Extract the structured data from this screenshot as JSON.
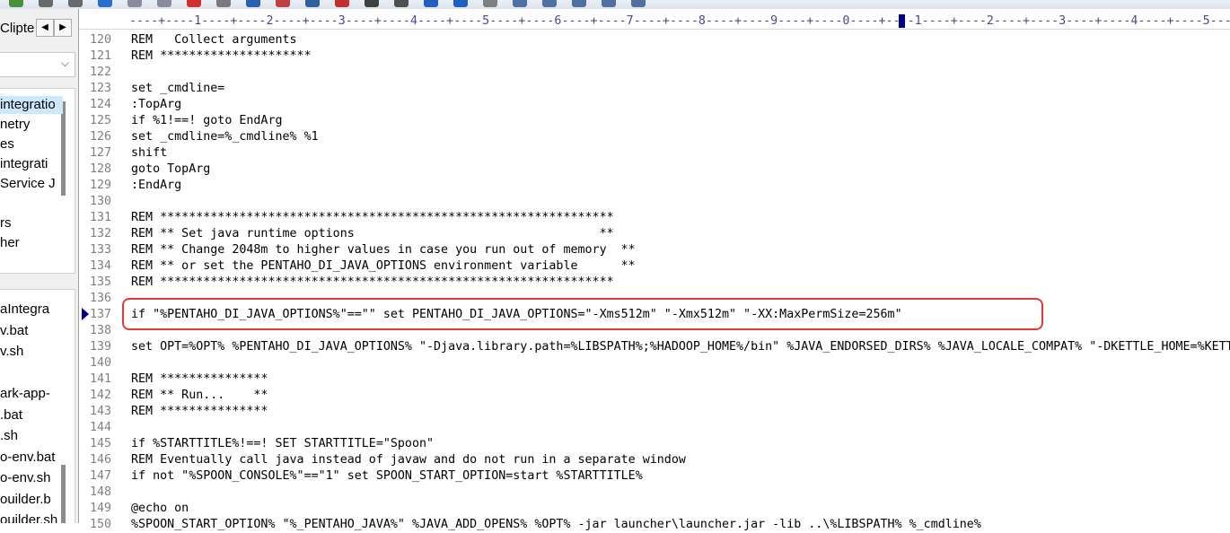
{
  "toolbar": {
    "icons": [
      "save-icon",
      "print-icon",
      "print-preview-icon",
      "check-icon",
      "copy-icon",
      "paste-icon",
      "delete-icon",
      "tools-icon",
      "find-icon",
      "replace-icon",
      "goto-icon",
      "font-icon",
      "format-icon",
      "run-icon",
      "indent-icon",
      "spell-icon",
      "settings-icon",
      "window-icon",
      "window2-icon",
      "window3-icon",
      "window4-icon",
      "macro-icon"
    ]
  },
  "left_panel": {
    "tab_label": "Clipte",
    "tab_prev": "◀",
    "tab_next": "▶",
    "dropdown_arrow": "⌵",
    "tree_top": [
      "integratio",
      "netry",
      "es",
      "integrati",
      " Service J",
      "",
      "rs",
      "her"
    ],
    "tree_bottom": [
      "aIntegra",
      "v.bat",
      "v.sh",
      "",
      "ark-app-",
      ".bat",
      ".sh",
      "o-env.bat",
      "o-env.sh",
      "ouilder.b",
      "ouilder.sh"
    ]
  },
  "editor": {
    "ruler": "----+----1----+----2----+----3----+----4----+----5----+----6----+----7----+----8----+----9----+----0----+----1----+----2----+----3----+----4----+----5----",
    "current_line": "137",
    "lines": [
      {
        "n": "120",
        "t": "REM   Collect arguments"
      },
      {
        "n": "121",
        "t": "REM *********************"
      },
      {
        "n": "122",
        "t": ""
      },
      {
        "n": "123",
        "t": "set _cmdline="
      },
      {
        "n": "124",
        "t": ":TopArg"
      },
      {
        "n": "125",
        "t": "if %1!==! goto EndArg"
      },
      {
        "n": "126",
        "t": "set _cmdline=%_cmdline% %1"
      },
      {
        "n": "127",
        "t": "shift"
      },
      {
        "n": "128",
        "t": "goto TopArg"
      },
      {
        "n": "129",
        "t": ":EndArg"
      },
      {
        "n": "130",
        "t": ""
      },
      {
        "n": "131",
        "t": "REM ***************************************************************"
      },
      {
        "n": "132",
        "t": "REM ** Set java runtime options                                  **"
      },
      {
        "n": "133",
        "t": "REM ** Change 2048m to higher values in case you run out of memory  **"
      },
      {
        "n": "134",
        "t": "REM ** or set the PENTAHO_DI_JAVA_OPTIONS environment variable      **"
      },
      {
        "n": "135",
        "t": "REM ***************************************************************"
      },
      {
        "n": "136",
        "t": ""
      },
      {
        "n": "137",
        "t": "if \"%PENTAHO_DI_JAVA_OPTIONS%\"==\"\" set PENTAHO_DI_JAVA_OPTIONS=\"-Xms512m\" \"-Xmx512m\" \"-XX:MaxPermSize=256m\""
      },
      {
        "n": "138",
        "t": ""
      },
      {
        "n": "139",
        "t": "set OPT=%OPT% %PENTAHO_DI_JAVA_OPTIONS% \"-Djava.library.path=%LIBSPATH%;%HADOOP_HOME%/bin\" %JAVA_ENDORSED_DIRS% %JAVA_LOCALE_COMPAT% \"-DKETTLE_HOME=%KETT"
      },
      {
        "n": "140",
        "t": ""
      },
      {
        "n": "141",
        "t": "REM ***************"
      },
      {
        "n": "142",
        "t": "REM ** Run...    **"
      },
      {
        "n": "143",
        "t": "REM ***************"
      },
      {
        "n": "144",
        "t": ""
      },
      {
        "n": "145",
        "t": "if %STARTTITLE%!==! SET STARTTITLE=\"Spoon\""
      },
      {
        "n": "146",
        "t": "REM Eventually call java instead of javaw and do not run in a separate window"
      },
      {
        "n": "147",
        "t": "if not \"%SPOON_CONSOLE%\"==\"1\" set SPOON_START_OPTION=start %STARTTITLE%"
      },
      {
        "n": "148",
        "t": ""
      },
      {
        "n": "149",
        "t": "@echo on"
      },
      {
        "n": "150",
        "t": "%SPOON_START_OPTION% \"%_PENTAHO_JAVA%\" %JAVA_ADD_OPENS% %OPT% -jar launcher\\launcher.jar -lib ..\\%LIBSPATH% %_cmdline%"
      }
    ]
  }
}
